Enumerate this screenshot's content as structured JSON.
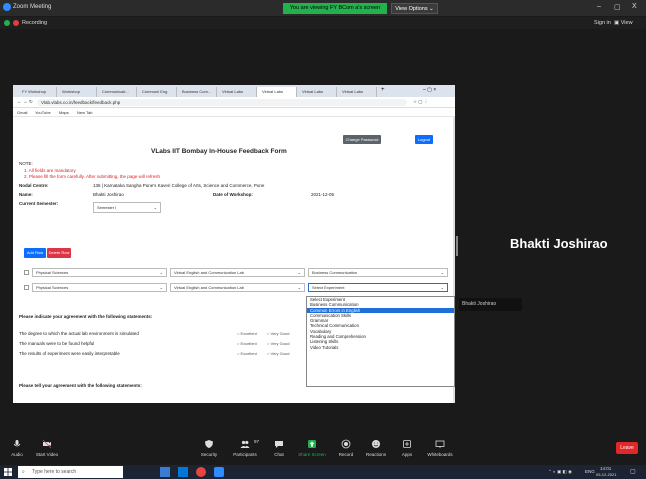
{
  "zoom": {
    "window_title": "Zoom Meeting",
    "share_banner": "You are viewing FY BCom a's screen",
    "view_options": "View Options",
    "recording": "Recording",
    "sign_in": "Sign in",
    "view": "View",
    "minimize": "–",
    "maximize": "▢",
    "close": "X"
  },
  "browser": {
    "tabs": [
      "FY Workshop",
      "Workshop",
      "Communicati...",
      "Communi Eng",
      "Business Com...",
      "Virtual Labs",
      "Virtual Labs",
      "Virtual Labs",
      "Virtual Labs"
    ],
    "url": "Vlab.vlabs.co.in/feedback/feedback.php",
    "bookmarks": [
      "Gmail",
      "YouTube",
      "Maps",
      "New Tab"
    ]
  },
  "form": {
    "change_password": "Change Password",
    "logout": "Logout",
    "title": "VLabs IIT Bombay In-House Feedback Form",
    "note_label": "NOTE:",
    "note_1": "1. All fields are mandatory",
    "note_2": "2. Please fill the form carefully. After submitting, the page will refresh",
    "nodal_label": "Nodal Centre:",
    "nodal_value": "136 | Karnataka Sangha Pune's Kaveri College of Arts, Science and Commerce, Pune",
    "name_label": "Name:",
    "name_value": "Bhakti Joshirao",
    "date_label": "Date of Workshop:",
    "date_value": "2021-12-05",
    "semester_label": "Current Semester:",
    "semester_value": "Semester I",
    "add_row": "Add Row",
    "delete_row": "Delete Row",
    "rows": [
      {
        "discipline": "Physical Sciences",
        "lab": "Virtual English and Communication Lab",
        "experiment": "Business Communication"
      },
      {
        "discipline": "Physical Sciences",
        "lab": "Virtual English and Communication Lab",
        "experiment": "Select Experiment"
      }
    ],
    "dropdown_options": [
      "Select Experiment",
      "Business Communication",
      "Common Errors in English",
      "Communication Skills",
      "Grammar",
      "Technical Communication",
      "Vocabulary",
      "Reading and Comprehension",
      "Listening Skills",
      "Video Tutorials"
    ],
    "dropdown_highlighted": 2,
    "agreement_heading": "Please indicate your agreement with the following statements:",
    "statements": [
      "The degree to which the actual lab environment is simulated",
      "The manuals were to be found helpful",
      "The results of experiment were easily interpretable"
    ],
    "opt_excellent": "Excellent",
    "opt_very_good": "Very Good",
    "tell_heading": "Please tell your agreement with the following statements:"
  },
  "participant": {
    "name": "Bhakti Joshirao",
    "tile_name": "Bhakti Joshirao"
  },
  "toolbar": {
    "audio": "Audio",
    "start_video": "Start Video",
    "security": "Security",
    "participants": "Participants",
    "participants_count": "97",
    "chat": "Chat",
    "share_screen": "Share Screen",
    "record": "Record",
    "reactions": "Reactions",
    "apps": "Apps",
    "whiteboards": "Whiteboards",
    "leave": "Leave"
  },
  "taskbar": {
    "search_placeholder": "Type here to search",
    "lang": "ENG",
    "time": "14:01",
    "date": "05-12-2021"
  },
  "colors": {
    "share_green": "#23b14d",
    "leave_red": "#e02828",
    "primary_blue": "#0d6efd"
  }
}
